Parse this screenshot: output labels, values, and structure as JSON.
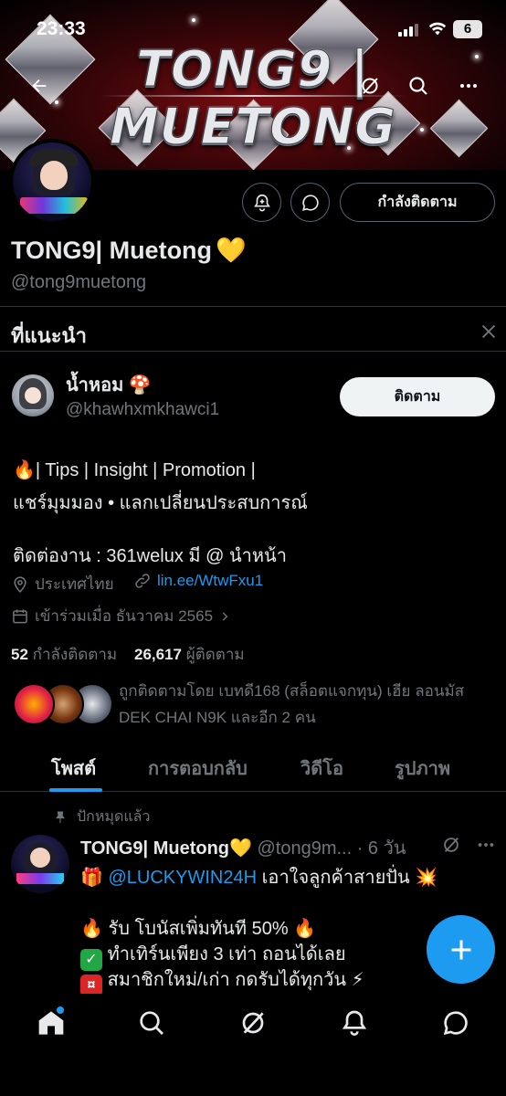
{
  "status_bar": {
    "time": "23:33",
    "battery": "6"
  },
  "banner": {
    "title": "TONG9 | MUETONG"
  },
  "profile": {
    "name": "TONG9| Muetong",
    "name_emoji": "💛",
    "handle": "@tong9muetong",
    "follow_state_label": "กำลังติดตาม"
  },
  "recommended": {
    "title": "ที่แนะนำ",
    "user": {
      "name": "น้ำหอม",
      "name_emoji": "🍄",
      "handle": "@khawhxmkhawci1",
      "follow_label": "ติดตาม"
    }
  },
  "bio": {
    "line1": "🔥| Tips | Insight | Promotion |",
    "line2": "แชร์มุมมอง • แลกเปลี่ยนประสบการณ์",
    "line3": "ติดต่องาน : 361welux มี @ นำหน้า"
  },
  "meta": {
    "location": "ประเทศไทย",
    "link": "lin.ee/WtwFxu1",
    "joined": "เข้าร่วมเมื่อ ธันวาคม 2565"
  },
  "stats": {
    "following_count": "52",
    "following_label": "กำลังติดตาม",
    "followers_count": "26,617",
    "followers_label": "ผู้ติดตาม"
  },
  "followed_by": {
    "text": "ถูกติดตามโดย เบทดี168 (สล็อตแจกทุน) เฮีย ลอนมัส DEK CHAI N9K และอีก 2 คน"
  },
  "tabs": [
    "โพสต์",
    "การตอบกลับ",
    "วิดีโอ",
    "รูปภาพ"
  ],
  "pinned_post": {
    "pinned_label": "ปักหมุดแล้ว",
    "author_name": "TONG9| Muetong💛",
    "author_handle": "@tong9m...",
    "time": "· 6 วัน",
    "line1_prefix": "🎁",
    "line1_mention": "@LUCKYWIN24H",
    "line1_text": "เอาใจลูกค้าสายปั่น 💥",
    "line2": "🔥 รับ โบนัสเพิ่มทันที 50% 🔥",
    "line3": "ทำเทิร์นเพียง 3 เท่า ถอนได้เลย",
    "line4": "สมาชิกใหม่/เก่า กดรับได้ทุกวัน ⚡"
  },
  "colors": {
    "accent": "#1d9bf0",
    "background": "#000000",
    "text_primary": "#e7e9ea",
    "text_secondary": "#71767b",
    "divider": "#2f3336"
  }
}
